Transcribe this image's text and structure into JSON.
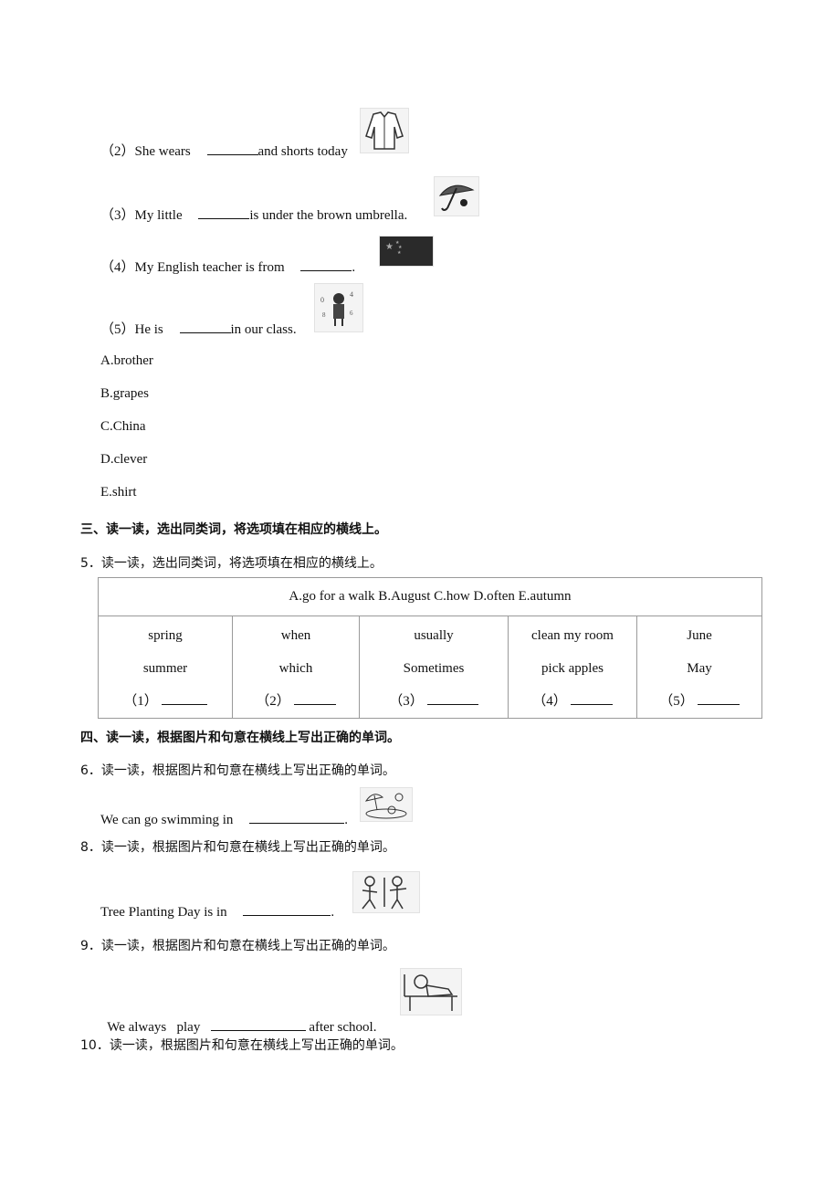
{
  "section2": {
    "items": [
      {
        "num": "（2）",
        "before": "She wears",
        "after": "and shorts today",
        "picture": "shirt-picture"
      },
      {
        "num": "（3）",
        "before": "My little",
        "after": "is under the brown umbrella.",
        "picture": "umbrella-picture"
      },
      {
        "num": "（4）",
        "before": "My English teacher is from",
        "after": ".",
        "picture": "china-flag-picture"
      },
      {
        "num": "（5）",
        "before": "He is",
        "after": "in our class.",
        "picture": "clever-boy-picture"
      }
    ],
    "options": [
      "A.brother",
      "B.grapes",
      "C.China",
      "D.clever",
      "E.shirt"
    ]
  },
  "section3": {
    "heading": "三、读一读，选出同类词，将选项填在相应的横线上。",
    "question": "5．读一读，选出同类词，将选项填在相应的横线上。",
    "table": {
      "header": "A.go for a walk B.August C.how D.often E.autumn",
      "columns": [
        {
          "words": [
            "spring",
            "summer"
          ],
          "blank": "（1）"
        },
        {
          "words": [
            "when",
            "which"
          ],
          "blank": "（2）"
        },
        {
          "words": [
            "usually",
            "Sometimes"
          ],
          "blank": "（3）"
        },
        {
          "words": [
            "clean my room",
            "pick apples"
          ],
          "blank": "（4）"
        },
        {
          "words": [
            "June",
            "May"
          ],
          "blank": "（5）"
        }
      ]
    }
  },
  "section4": {
    "heading": "四、读一读，根据图片和句意在横线上写出正确的单词。",
    "questions": [
      {
        "title": "6．读一读，根据图片和句意在横线上写出正确的单词。",
        "before": "We can go swimming in",
        "after": ".",
        "picture": "summer-beach-picture"
      },
      {
        "title": "8．读一读，根据图片和句意在横线上写出正确的单词。",
        "before": "Tree Planting Day is in",
        "after": ".",
        "picture": "tree-planting-picture"
      },
      {
        "title": "9．读一读，根据图片和句意在横线上写出正确的单词。",
        "before": "We always   play",
        "after": "after school.",
        "picture": "ping-pong-picture"
      },
      {
        "title": "10．读一读，根据图片和句意在横线上写出正确的单词。"
      }
    ]
  }
}
